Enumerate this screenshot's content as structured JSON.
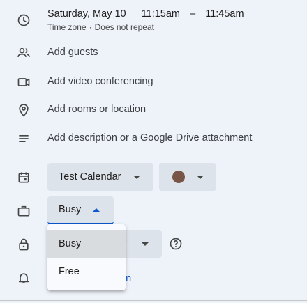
{
  "event": {
    "date": "Saturday, May 10",
    "start_time": "11:15am",
    "dash": "–",
    "end_time": "11:45am",
    "timezone": "Time zone",
    "bullet": "·",
    "repeat": "Does not repeat"
  },
  "options": {
    "guests": "Add guests",
    "video": "Add video conferencing",
    "location": "Add rooms or location",
    "description": "Add description or a Google Drive attachment"
  },
  "calendar": {
    "name": "Test Calendar",
    "color": "#795548"
  },
  "availability": {
    "selected": "Busy",
    "options": [
      "Busy",
      "Free"
    ]
  },
  "visibility": {
    "partial_label": "y"
  },
  "notification": {
    "partial_label": "on"
  },
  "colors": {
    "background": "#eef2f9",
    "chip": "#dde3ea",
    "accent": "#0b57d0",
    "link": "#0b57d0"
  },
  "icons": [
    "clock-icon",
    "people-icon",
    "video-camera-icon",
    "location-pin-icon",
    "notes-icon",
    "calendar-icon",
    "briefcase-icon",
    "lock-icon",
    "bell-icon",
    "help-icon"
  ]
}
